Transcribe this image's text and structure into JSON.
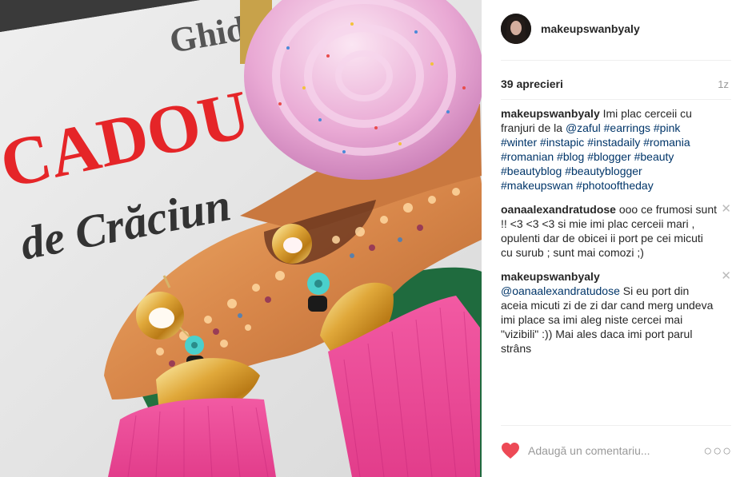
{
  "post": {
    "username": "makeupswanbyaly",
    "likes": "39 aprecieri",
    "time": "1z",
    "caption": {
      "user": "makeupswanbyaly",
      "text": "Imi plac cerceii cu franjuri de la",
      "mention": "@zaful",
      "hashtags": [
        "#earrings",
        "#pink",
        "#winter",
        "#instapic",
        "#instadaily",
        "#romania",
        "#romanian",
        "#blog",
        "#blogger",
        "#beauty",
        "#beautyblog",
        "#beautyblogger",
        "#makeupswan",
        "#photooftheday"
      ]
    },
    "comments": [
      {
        "user": "oanaalexandratudose",
        "mention": "",
        "text": "ooo ce frumosi sunt !! <3 <3 <3 si mie imi plac cerceii mari , opulenti dar de obicei ii port pe cei micuti cu surub ; sunt mai comozi ;)"
      },
      {
        "user": "makeupswanbyaly",
        "mention": "@oanaalexandratudose",
        "text": "Si eu port din aceia micuti zi de zi dar cand merg undeva imi place sa imi aleg niste cercei mai \"vizibili\" :)) Mai ales daca imi port parul strâns"
      }
    ],
    "comment_placeholder": "Adaugă un comentariu...",
    "more_label": "○○○"
  },
  "photo": {
    "magazine_line1": "Ghid",
    "magazine_line2": "CADOU",
    "magazine_line3": "de Crăciun"
  },
  "colors": {
    "hashtag": "#003569",
    "like_heart": "#ed4956",
    "text": "#262626",
    "muted": "#999999"
  },
  "icons": {
    "like": "heart-icon",
    "close": "close-icon",
    "more": "more-options-icon"
  }
}
